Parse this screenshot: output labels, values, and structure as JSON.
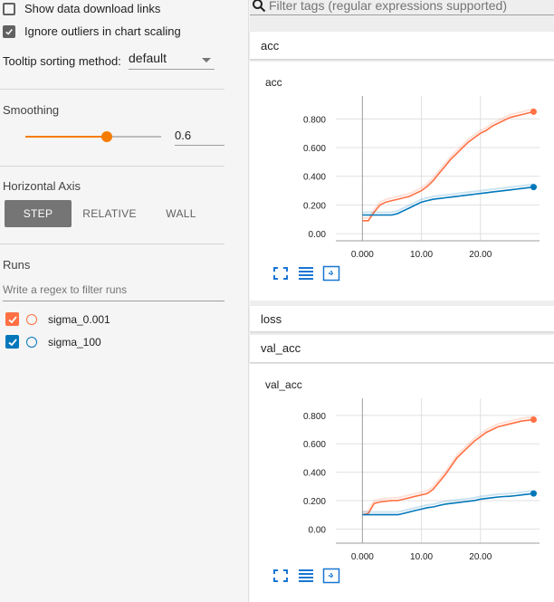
{
  "sidebar": {
    "show_download_label": "Show data download links",
    "show_download_checked": false,
    "ignore_outliers_label": "Ignore outliers in chart scaling",
    "ignore_outliers_checked": true,
    "tooltip_label": "Tooltip sorting method:",
    "tooltip_value": "default",
    "smoothing_title": "Smoothing",
    "smoothing_value": "0.6",
    "smoothing_fraction": 0.6,
    "horizontal_axis_title": "Horizontal Axis",
    "axis_options": [
      "STEP",
      "RELATIVE",
      "WALL"
    ],
    "axis_selected": "STEP",
    "runs_title": "Runs",
    "runs_filter_placeholder": "Write a regex to filter runs",
    "runs": [
      {
        "name": "sigma_0.001",
        "color": "#ff7043",
        "checked": true
      },
      {
        "name": "sigma_100",
        "color": "#0077bb",
        "checked": true
      }
    ]
  },
  "main": {
    "filter_placeholder": "Filter tags (regular expressions supported)",
    "categories": {
      "acc": "acc",
      "loss": "loss",
      "val_acc": "val_acc"
    }
  },
  "chart_data": [
    {
      "type": "line",
      "title": "acc",
      "xlabel": "",
      "ylabel": "",
      "x_ticks": [
        "0.000",
        "10.00",
        "20.00"
      ],
      "y_ticks": [
        "0.00",
        "0.200",
        "0.400",
        "0.600",
        "0.800"
      ],
      "xlim": [
        -4.5,
        30
      ],
      "ylim": [
        -0.05,
        0.96
      ],
      "series": [
        {
          "name": "sigma_0.001",
          "color": "#ff7043",
          "x": [
            0,
            1,
            2,
            3,
            4,
            5,
            6,
            7,
            8,
            9,
            10,
            11,
            12,
            13,
            14,
            15,
            16,
            17,
            18,
            19,
            20,
            21,
            22,
            23,
            24,
            25,
            26,
            27,
            28,
            29
          ],
          "y": [
            0.09,
            0.09,
            0.15,
            0.2,
            0.22,
            0.23,
            0.24,
            0.25,
            0.26,
            0.28,
            0.3,
            0.33,
            0.37,
            0.42,
            0.47,
            0.52,
            0.56,
            0.6,
            0.64,
            0.67,
            0.7,
            0.72,
            0.75,
            0.77,
            0.79,
            0.81,
            0.82,
            0.83,
            0.84,
            0.85
          ]
        },
        {
          "name": "sigma_100",
          "color": "#0077bb",
          "x": [
            0,
            1,
            2,
            3,
            4,
            5,
            6,
            7,
            8,
            9,
            10,
            11,
            12,
            13,
            14,
            15,
            16,
            17,
            18,
            19,
            20,
            21,
            22,
            23,
            24,
            25,
            26,
            27,
            28,
            29
          ],
          "y": [
            0.13,
            0.13,
            0.13,
            0.13,
            0.13,
            0.13,
            0.14,
            0.16,
            0.18,
            0.2,
            0.22,
            0.23,
            0.24,
            0.245,
            0.25,
            0.255,
            0.26,
            0.265,
            0.27,
            0.275,
            0.28,
            0.285,
            0.29,
            0.295,
            0.3,
            0.305,
            0.31,
            0.315,
            0.32,
            0.325
          ]
        }
      ]
    },
    {
      "type": "line",
      "title": "val_acc",
      "xlabel": "",
      "ylabel": "",
      "x_ticks": [
        "0.000",
        "10.00",
        "20.00"
      ],
      "y_ticks": [
        "0.00",
        "0.200",
        "0.400",
        "0.600",
        "0.800"
      ],
      "xlim": [
        -4.5,
        30
      ],
      "ylim": [
        -0.1,
        0.92
      ],
      "series": [
        {
          "name": "sigma_0.001",
          "color": "#ff7043",
          "x": [
            0,
            1,
            2,
            3,
            4,
            5,
            6,
            7,
            8,
            9,
            10,
            11,
            12,
            13,
            14,
            15,
            16,
            17,
            18,
            19,
            20,
            21,
            22,
            23,
            24,
            25,
            26,
            27,
            28,
            29
          ],
          "y": [
            0.1,
            0.11,
            0.18,
            0.19,
            0.195,
            0.2,
            0.2,
            0.21,
            0.22,
            0.23,
            0.24,
            0.25,
            0.28,
            0.33,
            0.38,
            0.44,
            0.5,
            0.54,
            0.58,
            0.62,
            0.65,
            0.68,
            0.7,
            0.72,
            0.73,
            0.74,
            0.75,
            0.76,
            0.765,
            0.77
          ]
        },
        {
          "name": "sigma_100",
          "color": "#0077bb",
          "x": [
            0,
            1,
            2,
            3,
            4,
            5,
            6,
            7,
            8,
            9,
            10,
            11,
            12,
            13,
            14,
            15,
            16,
            17,
            18,
            19,
            20,
            21,
            22,
            23,
            24,
            25,
            26,
            27,
            28,
            29
          ],
          "y": [
            0.1,
            0.1,
            0.1,
            0.1,
            0.1,
            0.1,
            0.1,
            0.11,
            0.12,
            0.13,
            0.14,
            0.15,
            0.155,
            0.165,
            0.175,
            0.18,
            0.185,
            0.19,
            0.195,
            0.2,
            0.21,
            0.215,
            0.22,
            0.225,
            0.228,
            0.23,
            0.235,
            0.24,
            0.245,
            0.25
          ]
        }
      ]
    }
  ]
}
